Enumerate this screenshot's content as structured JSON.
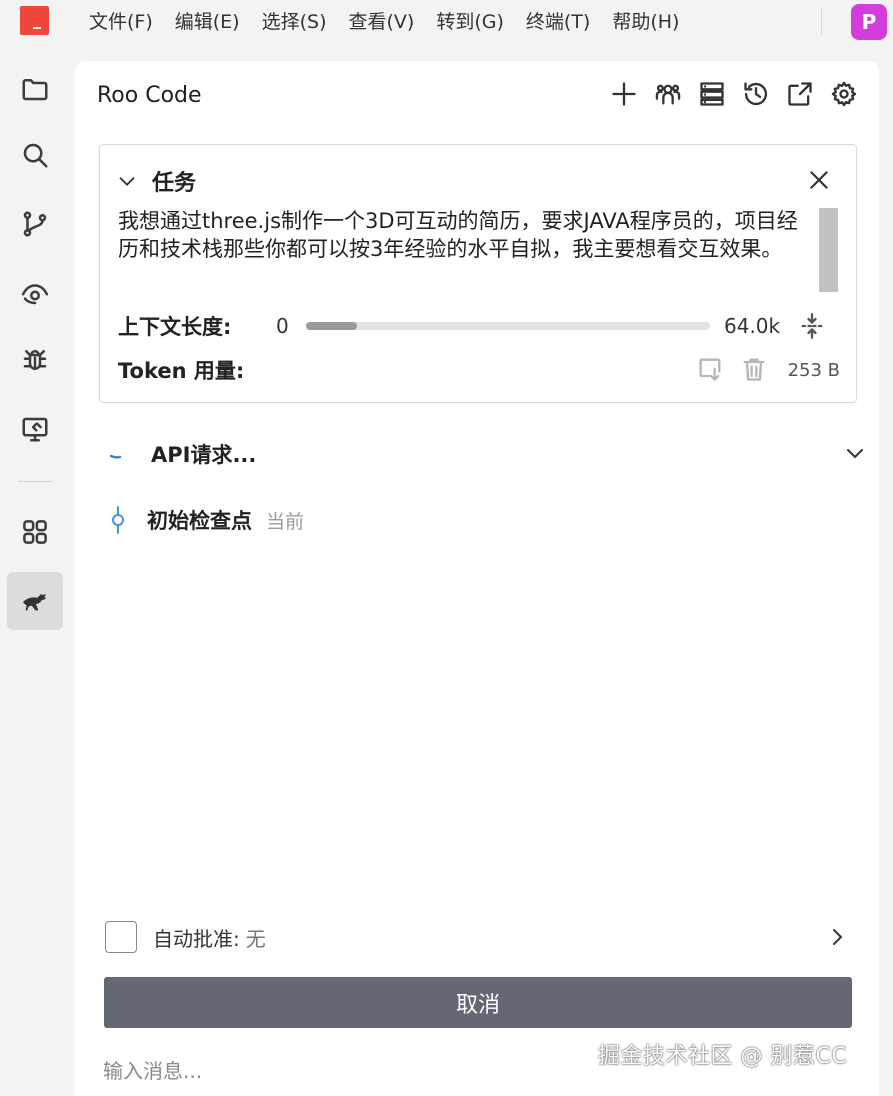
{
  "menubar": {
    "items": [
      "文件(F)",
      "编辑(E)",
      "选择(S)",
      "查看(V)",
      "转到(G)",
      "终端(T)",
      "帮助(H)"
    ],
    "avatar_letter": "P",
    "logo_color": "#f0473b",
    "avatar_color": "#d23ddc"
  },
  "activitybar": {
    "items": [
      {
        "icon": "folder-icon"
      },
      {
        "icon": "search-icon"
      },
      {
        "icon": "source-control-icon"
      },
      {
        "icon": "eye-icon"
      },
      {
        "icon": "debug-bug-icon"
      },
      {
        "icon": "remote-monitor-icon"
      },
      {
        "icon": "extensions-icon"
      },
      {
        "icon": "kangaroo-icon",
        "active": true
      }
    ]
  },
  "panel": {
    "title": "Roo Code",
    "actions": [
      "plus-icon",
      "team-icon",
      "server-icon",
      "history-icon",
      "popout-icon",
      "gear-icon"
    ]
  },
  "task": {
    "heading": "任务",
    "text": "我想通过three.js制作一个3D可互动的简历，要求JAVA程序员的，项目经历和技术栈那些你都可以按3年经验的水平自拟，我主要想看交互效果。",
    "context_label": "上下文长度:",
    "context_min": "0",
    "context_max": "64.0k",
    "context_used_fraction": 0.125,
    "token_label": "Token 用量:",
    "token_value": "253 B"
  },
  "api": {
    "label": "API请求..."
  },
  "checkpoint": {
    "label": "初始检查点",
    "sub": "当前"
  },
  "bottom": {
    "auto_label": "自动批准:",
    "auto_value": "无",
    "cancel_label": "取消",
    "input_placeholder": "输入消息..."
  },
  "watermark": "掘金技术社区 @ 别惹CC"
}
